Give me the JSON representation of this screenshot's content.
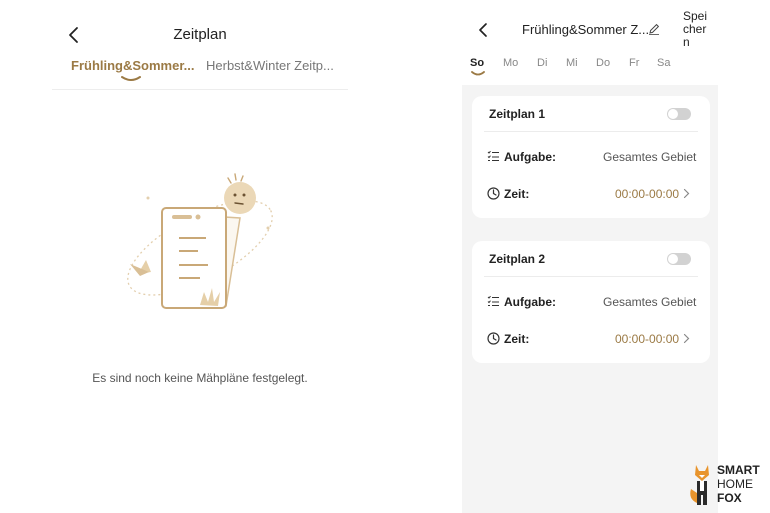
{
  "left": {
    "title": "Zeitplan",
    "tabs": [
      {
        "label": "Frühling&Sommer...",
        "active": true
      },
      {
        "label": "Herbst&Winter Zeitp...",
        "active": false
      }
    ],
    "empty_message": "Es sind noch keine Mähpläne festgelegt."
  },
  "right": {
    "title": "Frühling&Sommer Z...",
    "save_label": "Speichern",
    "days": [
      {
        "label": "So",
        "active": true
      },
      {
        "label": "Mo",
        "active": false
      },
      {
        "label": "Di",
        "active": false
      },
      {
        "label": "Mi",
        "active": false
      },
      {
        "label": "Do",
        "active": false
      },
      {
        "label": "Fr",
        "active": false
      },
      {
        "label": "Sa",
        "active": false
      }
    ],
    "schedules": [
      {
        "title": "Zeitplan 1",
        "enabled": false,
        "task_label": "Aufgabe:",
        "task_value": "Gesamtes Gebiet",
        "time_label": "Zeit:",
        "time_value": "00:00-00:00"
      },
      {
        "title": "Zeitplan 2",
        "enabled": false,
        "task_label": "Aufgabe:",
        "task_value": "Gesamtes Gebiet",
        "time_label": "Zeit:",
        "time_value": "00:00-00:00"
      }
    ]
  },
  "logo": {
    "line1": "SMART",
    "line2": "HOME",
    "line3": "FOX"
  },
  "icons": {
    "back": "chevron-left-icon",
    "edit": "pencil-icon",
    "task": "checklist-icon",
    "time": "clock-icon",
    "chevron": "chevron-right-icon"
  },
  "colors": {
    "accent": "#9b7a45",
    "toggle_off": "#d2d2d2",
    "panel_bg": "#f4f4f4"
  }
}
